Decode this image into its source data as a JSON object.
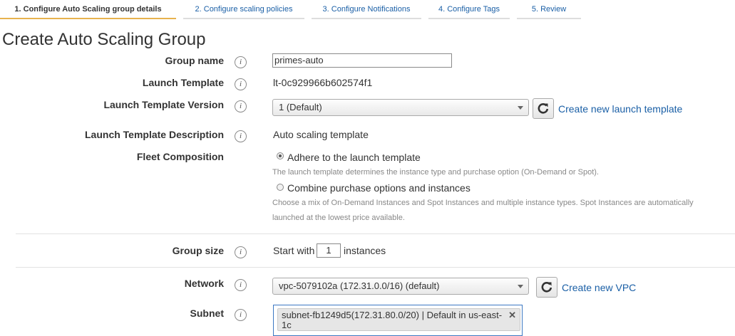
{
  "wizard": {
    "steps": [
      {
        "label": "1. Configure Auto Scaling group details",
        "active": true
      },
      {
        "label": "2. Configure scaling policies",
        "active": false
      },
      {
        "label": "3. Configure Notifications",
        "active": false
      },
      {
        "label": "4. Configure Tags",
        "active": false
      },
      {
        "label": "5. Review",
        "active": false
      }
    ]
  },
  "page": {
    "title": "Create Auto Scaling Group"
  },
  "info_glyph": "i",
  "form": {
    "group_name": {
      "label": "Group name",
      "value": "primes-auto"
    },
    "launch_template": {
      "label": "Launch Template",
      "value": "lt-0c929966b602574f1"
    },
    "launch_template_version": {
      "label": "Launch Template Version",
      "selected": "1 (Default)",
      "create_link": "Create new launch template"
    },
    "launch_template_description": {
      "label": "Launch Template Description",
      "value": "Auto scaling template"
    },
    "fleet_composition": {
      "label": "Fleet Composition",
      "options": [
        {
          "label": "Adhere to the launch template",
          "help": "The launch template determines the instance type and purchase option (On-Demand or Spot).",
          "selected": true
        },
        {
          "label": "Combine purchase options and instances",
          "help_line1": "Choose a mix of On-Demand Instances and Spot Instances and multiple instance types. Spot Instances are automatically",
          "help_line2": "launched at the lowest price available.",
          "selected": false
        }
      ]
    },
    "group_size": {
      "label": "Group size",
      "prefix": "Start with",
      "value": "1",
      "suffix": "instances"
    },
    "network": {
      "label": "Network",
      "selected": "vpc-5079102a (172.31.0.0/16) (default)",
      "create_link": "Create new VPC"
    },
    "subnet": {
      "label": "Subnet",
      "chip": "subnet-fb1249d5(172.31.80.0/20) | Default in us-east-1c",
      "remove_glyph": "✕"
    }
  },
  "colors": {
    "link": "#1a5fa6",
    "active_tab_border": "#e8b24e",
    "focus_border": "#3c78c2"
  }
}
